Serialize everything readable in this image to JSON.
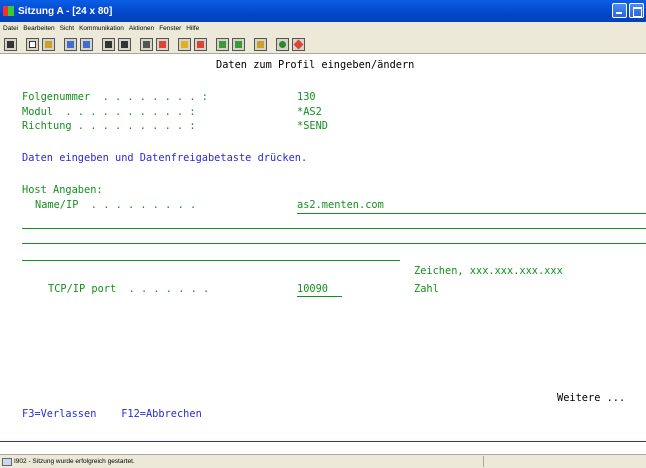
{
  "window": {
    "title": "Sitzung A - [24 x 80]"
  },
  "menu": [
    "Datei",
    "Bearbeiten",
    "Sicht",
    "Kommunikation",
    "Aktionen",
    "Fenster",
    "Hilfe"
  ],
  "toolbar": {
    "buttons": [
      "print-screen-icon",
      "copy-icon",
      "paste-icon",
      "send-icon",
      "receive-icon",
      "display-icon",
      "keypad-icon",
      "macro-icon",
      "record-icon",
      "play-icon",
      "transfer-icon",
      "upload-icon",
      "download-icon",
      "clipboard-icon",
      "color-icon",
      "edit-icon"
    ]
  },
  "screen": {
    "heading": "Daten zum Profil eingeben/ändern",
    "folgenummer_label": "Folgenummer  . . . . . . . . :",
    "folgenummer_value": "130",
    "modul_label": "Modul  . . . . . . . . . . :",
    "modul_value": "*AS2",
    "richtung_label": "Richtung . . . . . . . . . :",
    "richtung_value": "*SEND",
    "instruction": "Daten eingeben und Datenfreigabetaste drücken.",
    "host_heading": "Host Angaben:",
    "name_ip_label": "Name/IP  . . . . . . . . .",
    "name_ip_value": "as2.menten.com",
    "name_ip_hint": "Zeichen, xxx.xxx.xxx.xxx",
    "port_label": "TCP/IP port  . . . . . . .",
    "port_value": "10090",
    "port_hint": "Zahl",
    "more": "Weitere ...",
    "fkeys": "F3=Verlassen    F12=Abbrechen"
  },
  "status": {
    "message": "I902 - Sitzung wurde erfolgreich gestartet."
  },
  "colors": {
    "field": "#14901e",
    "text": "#000000",
    "info": "#2b2bd0",
    "titlebar": "#0346c8"
  }
}
